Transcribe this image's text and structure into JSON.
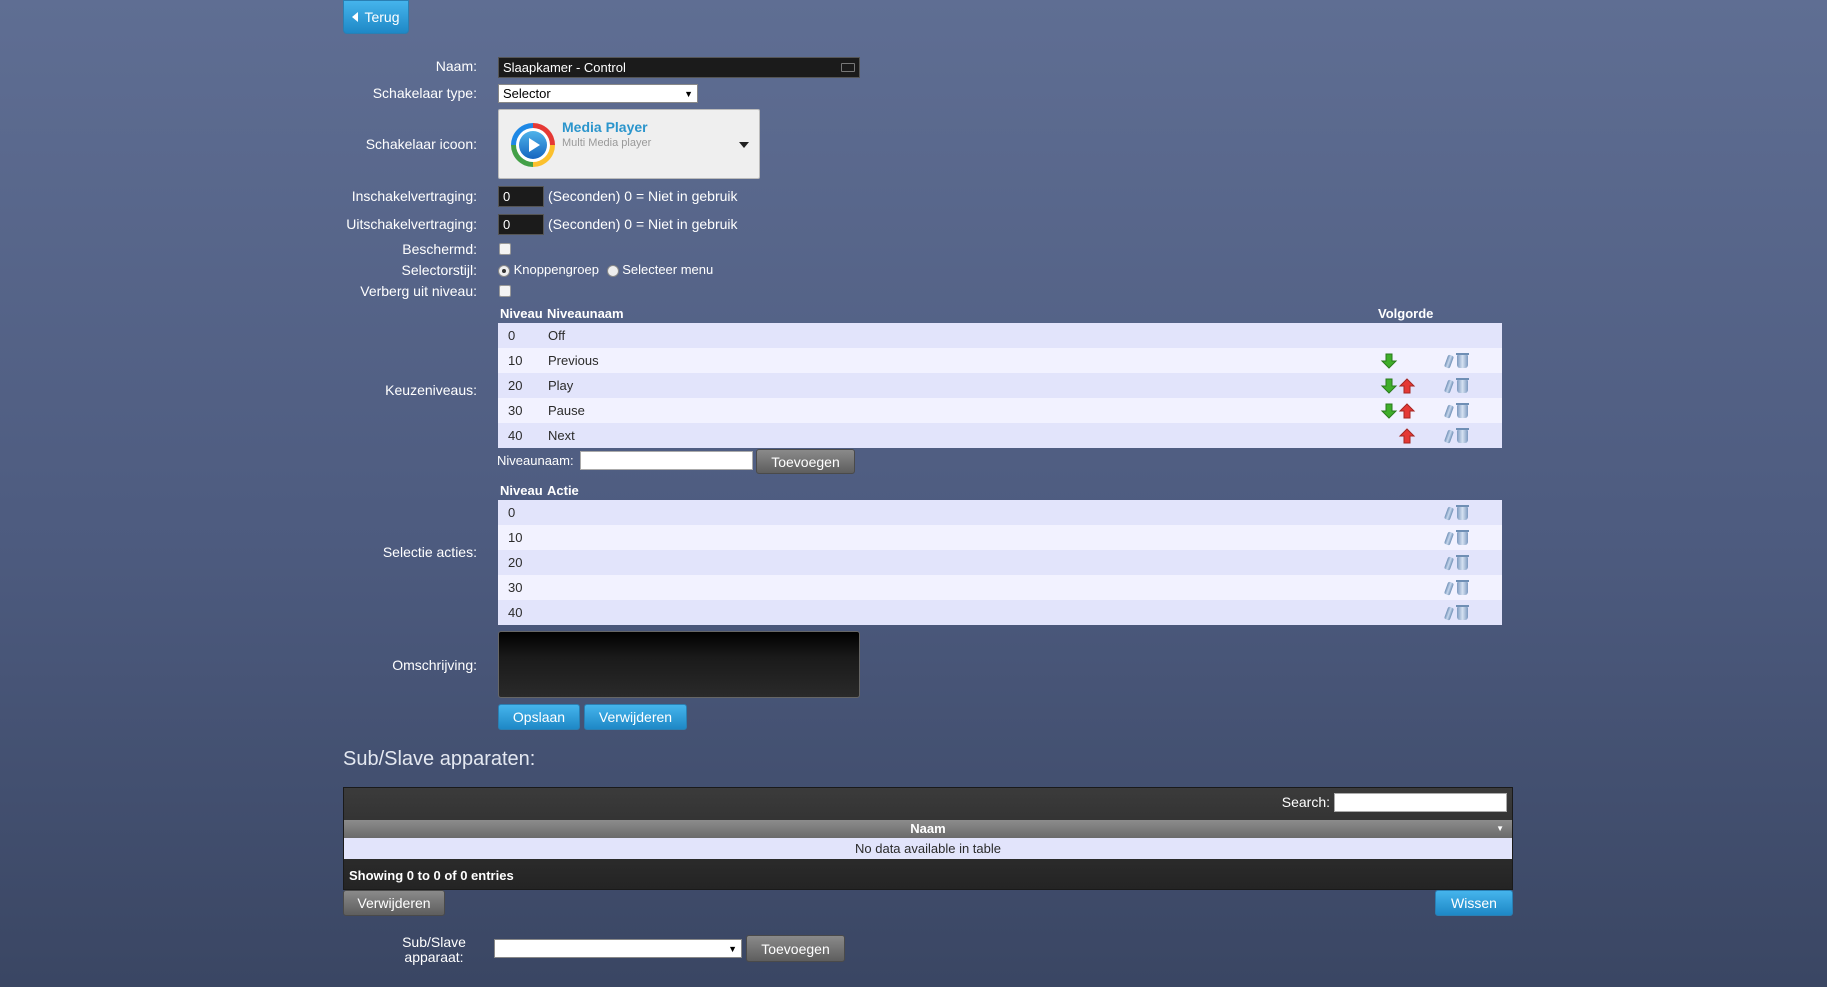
{
  "back_button": {
    "label": "Terug"
  },
  "form": {
    "name_label": "Naam:",
    "name_value": "Slaapkamer - Control",
    "switch_type_label": "Schakelaar type:",
    "switch_type_value": "Selector",
    "switch_icon_label": "Schakelaar icoon:",
    "icon_title": "Media Player",
    "icon_subtitle": "Multi Media player",
    "on_delay_label": "Inschakelvertraging:",
    "on_delay_value": "0",
    "on_delay_hint": "(Seconden) 0 = Niet in gebruik",
    "off_delay_label": "Uitschakelvertraging:",
    "off_delay_value": "0",
    "off_delay_hint": "(Seconden) 0 = Niet in gebruik",
    "protected_label": "Beschermd:",
    "selector_style_label": "Selectorstijl:",
    "selector_style_option_1": "Knoppengroep",
    "selector_style_option_2": "Selecteer menu",
    "hide_off_label": "Verberg uit niveau:",
    "levels_label": "Keuzeniveaus:",
    "selection_actions_label": "Selectie acties:",
    "description_label": "Omschrijving:",
    "save_button": "Opslaan",
    "delete_button": "Verwijderen"
  },
  "levels_table": {
    "headers": {
      "level": "Niveau",
      "name": "Niveaunaam",
      "order": "Volgorde"
    },
    "rows": [
      {
        "level": "0",
        "name": "Off",
        "down": false,
        "up": false
      },
      {
        "level": "10",
        "name": "Previous",
        "down": true,
        "up": false
      },
      {
        "level": "20",
        "name": "Play",
        "down": true,
        "up": true
      },
      {
        "level": "30",
        "name": "Pause",
        "down": true,
        "up": true
      },
      {
        "level": "40",
        "name": "Next",
        "down": false,
        "up": true
      }
    ],
    "add_label": "Niveaunaam:",
    "add_button": "Toevoegen"
  },
  "actions_table": {
    "headers": {
      "level": "Niveau",
      "action": "Actie"
    },
    "rows": [
      {
        "level": "0"
      },
      {
        "level": "10"
      },
      {
        "level": "20"
      },
      {
        "level": "30"
      },
      {
        "level": "40"
      }
    ]
  },
  "subslave": {
    "title": "Sub/Slave apparaten:",
    "search_label": "Search:",
    "column_name": "Naam",
    "empty_text": "No data available in table",
    "info_text": "Showing 0 to 0 of 0 entries",
    "delete_button": "Verwijderen",
    "clear_button": "Wissen",
    "device_label": "Sub/Slave apparaat:",
    "add_button": "Toevoegen"
  },
  "colors": {
    "accent": "#2a9bd8",
    "background": "#55648a"
  }
}
